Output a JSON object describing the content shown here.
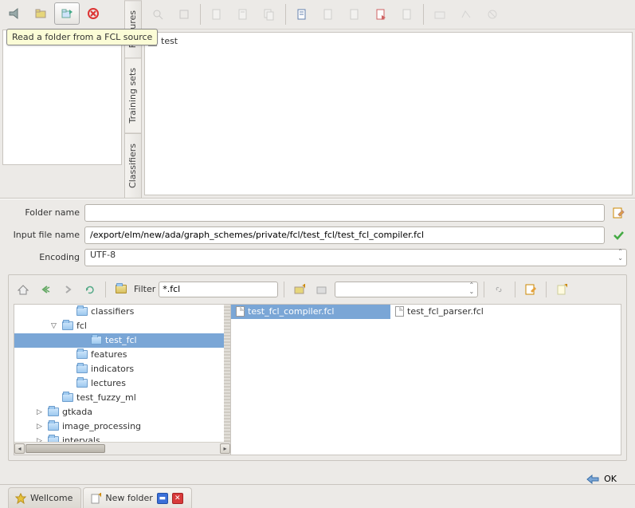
{
  "tooltip": "Read a folder from a FCL source",
  "vtabs": {
    "t0": "Features",
    "t1": "Training sets",
    "t2": "Classifiers"
  },
  "content": {
    "test_label": "test"
  },
  "form": {
    "folder_label": "Folder name",
    "folder_value": "",
    "input_label": "Input file name",
    "input_value": "/export/elm/new/ada/graph_schemes/private/fcl/test_fcl/test_fcl_compiler.fcl",
    "encoding_label": "Encoding",
    "encoding_value": "UTF-8"
  },
  "browser": {
    "filter_label": "Filter",
    "filter_value": "*.fcl",
    "tree": [
      {
        "indent": 3,
        "label": "classifiers",
        "exp": ""
      },
      {
        "indent": 2,
        "label": "fcl",
        "exp": "▽"
      },
      {
        "indent": 4,
        "label": "test_fcl",
        "exp": "",
        "sel": true
      },
      {
        "indent": 3,
        "label": "features",
        "exp": ""
      },
      {
        "indent": 3,
        "label": "indicators",
        "exp": ""
      },
      {
        "indent": 3,
        "label": "lectures",
        "exp": ""
      },
      {
        "indent": 2,
        "label": "test_fuzzy_ml",
        "exp": ""
      },
      {
        "indent": 1,
        "label": "gtkada",
        "exp": "▷"
      },
      {
        "indent": 1,
        "label": "image_processing",
        "exp": "▷"
      },
      {
        "indent": 1,
        "label": "intervals",
        "exp": "▷"
      }
    ],
    "files": [
      {
        "name": "test_fcl_compiler.fcl",
        "sel": true
      },
      {
        "name": "test_fcl_parser.fcl",
        "sel": false
      }
    ]
  },
  "ok_label": "OK",
  "tabs": {
    "wellcome": "Wellcome",
    "newfolder": "New folder"
  }
}
